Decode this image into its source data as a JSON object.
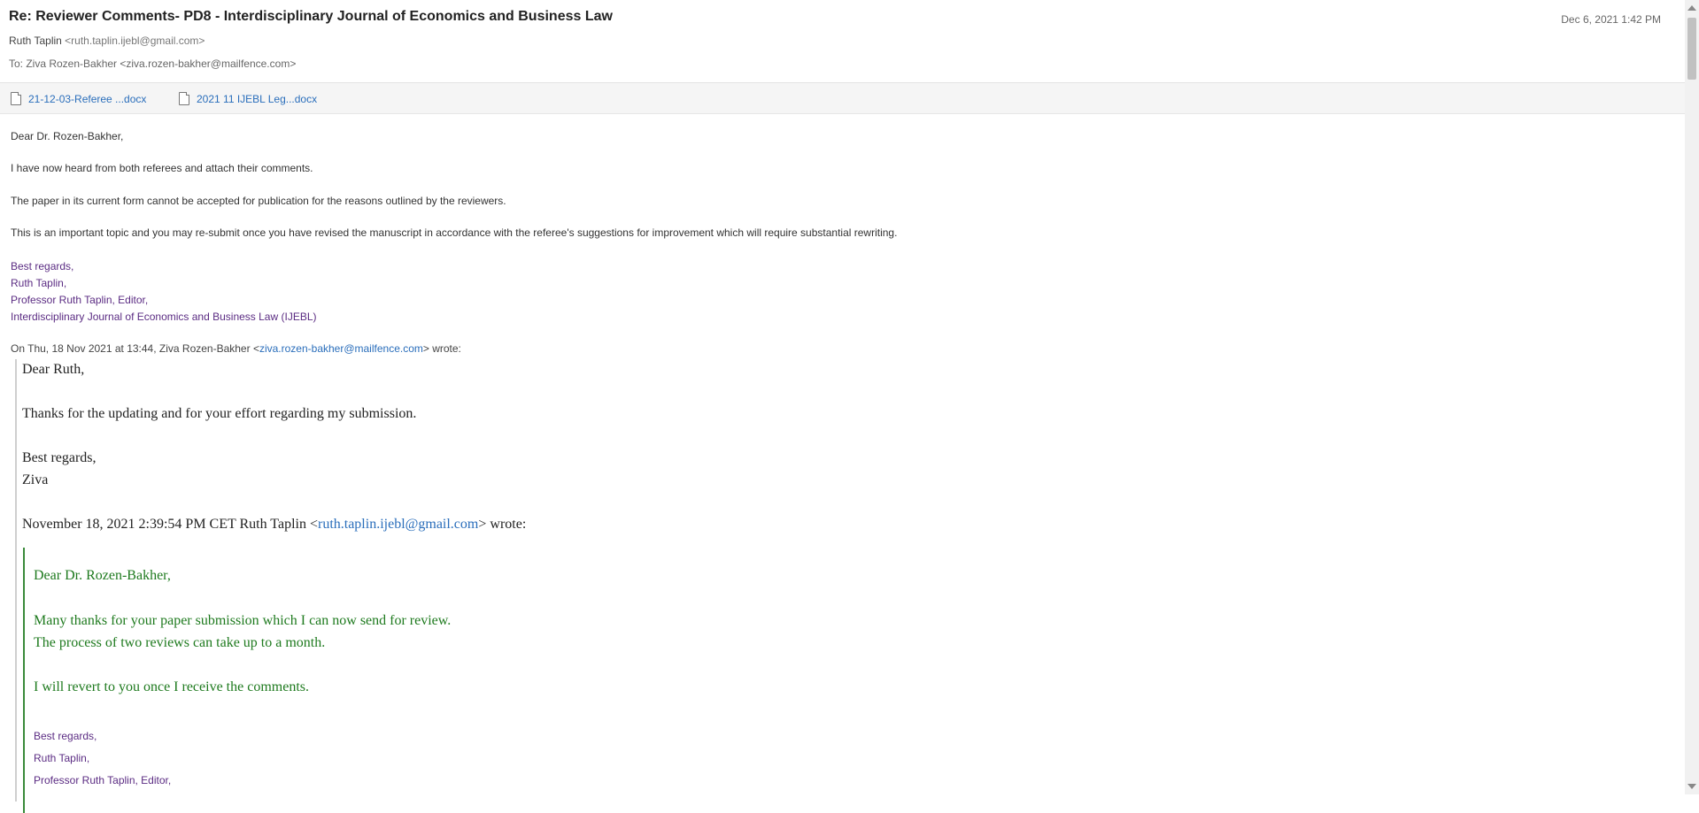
{
  "header": {
    "subject": "Re: Reviewer Comments- PD8 - Interdisciplinary Journal of Economics and Business Law",
    "date": "Dec 6, 2021 1:42 PM",
    "from_name": "Ruth Taplin",
    "from_addr": "<ruth.taplin.ijebl@gmail.com>",
    "to_line": "To: Ziva Rozen-Bakher <ziva.rozen-bakher@mailfence.com>"
  },
  "attachments": [
    {
      "name": "21-12-03-Referee ...docx"
    },
    {
      "name": "2021 11 IJEBL Leg...docx"
    }
  ],
  "message": {
    "greeting": "Dear Dr. Rozen-Bakher,",
    "p1": "I have now heard from both referees and attach their comments.",
    "p2": "The paper in its current form cannot be accepted for publication for the reasons outlined by the reviewers.",
    "p3": "This is an important topic and you may re-submit once you have revised the manuscript in accordance with the referee's suggestions for improvement which will require substantial rewriting.",
    "sig": [
      "Best regards,",
      "Ruth Taplin,",
      "Professor Ruth Taplin, Editor,",
      "Interdisciplinary Journal of Economics and Business Law (IJEBL)"
    ],
    "reply_header_pre": "On Thu, 18 Nov 2021 at 13:44, Ziva Rozen-Bakher <",
    "reply_header_link": "ziva.rozen-bakher@mailfence.com",
    "reply_header_post": "> wrote:"
  },
  "quote1": {
    "greeting": "Dear Ruth,",
    "body": "Thanks for the updating and for your effort regarding my submission.",
    "closing": "Best regards,",
    "name": "Ziva",
    "reply_header_pre": "November 18, 2021 2:39:54 PM CET Ruth Taplin <",
    "reply_header_link": "ruth.taplin.ijebl@gmail.com",
    "reply_header_post": "> wrote:"
  },
  "quote2": {
    "greeting": "Dear Dr. Rozen-Bakher,",
    "line1": "Many thanks for your paper submission which I can now send for review.",
    "line2": "The process of two reviews can take up to a month.",
    "line3": "I will revert to you once I receive the comments.",
    "sig": [
      "Best regards,",
      "Ruth Taplin,",
      "Professor Ruth Taplin, Editor,"
    ]
  },
  "colors": {
    "link": "#2a6ebb",
    "signature": "#5b2c83",
    "quote_green": "#1e7a1e"
  }
}
